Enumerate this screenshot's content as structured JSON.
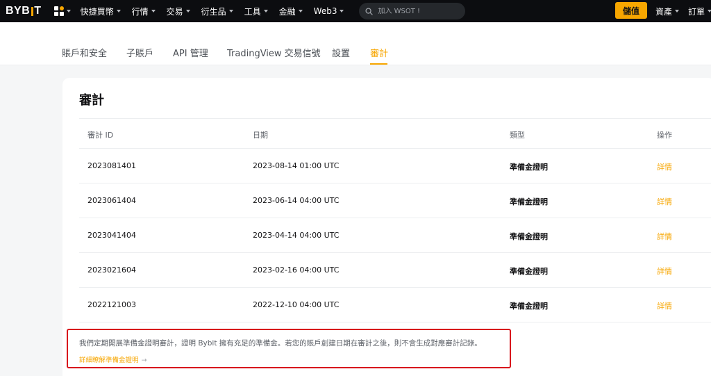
{
  "header": {
    "logo_left": "BYB",
    "logo_right": "T",
    "nav": [
      "快捷買幣",
      "行情",
      "交易",
      "衍生品",
      "工具",
      "金融",
      "Web3"
    ],
    "search_placeholder": "加入 WSOT !",
    "deposit_label": "儲值",
    "assets_label": "資產",
    "orders_label": "訂單"
  },
  "tabs": [
    "賬戶和安全",
    "子賬戶",
    "API 管理",
    "TradingView 交易信號",
    "設置",
    "審計"
  ],
  "active_tab": 5,
  "audit": {
    "title": "審計",
    "columns": {
      "id": "審計 ID",
      "date": "日期",
      "type": "類型",
      "action": "操作"
    },
    "rows": [
      {
        "id": "2023081401",
        "date": "2023-08-14 01:00 UTC",
        "type": "準備金證明",
        "action": "詳情"
      },
      {
        "id": "2023061404",
        "date": "2023-06-14 04:00 UTC",
        "type": "準備金證明",
        "action": "詳情"
      },
      {
        "id": "2023041404",
        "date": "2023-04-14 04:00 UTC",
        "type": "準備金證明",
        "action": "詳情"
      },
      {
        "id": "2023021604",
        "date": "2023-02-16 04:00 UTC",
        "type": "準備金證明",
        "action": "詳情"
      },
      {
        "id": "2022121003",
        "date": "2022-12-10 04:00 UTC",
        "type": "準備金證明",
        "action": "詳情"
      }
    ],
    "notice": "我們定期開展準備金證明審計，證明 Bybit 擁有充足的準備金。若您的賬戶創建日期在審計之後，則不會生成對應審計記錄。",
    "notice_link": "詳細瞭解準備金證明",
    "notice_arrow": "→"
  },
  "colors": {
    "accent": "#f7a600",
    "topbar": "#0c0d10",
    "highlight_border": "#d8141c"
  },
  "icons": {
    "apps": "apps-grid-icon",
    "search": "search-icon",
    "caret": "chevron-down-icon"
  }
}
